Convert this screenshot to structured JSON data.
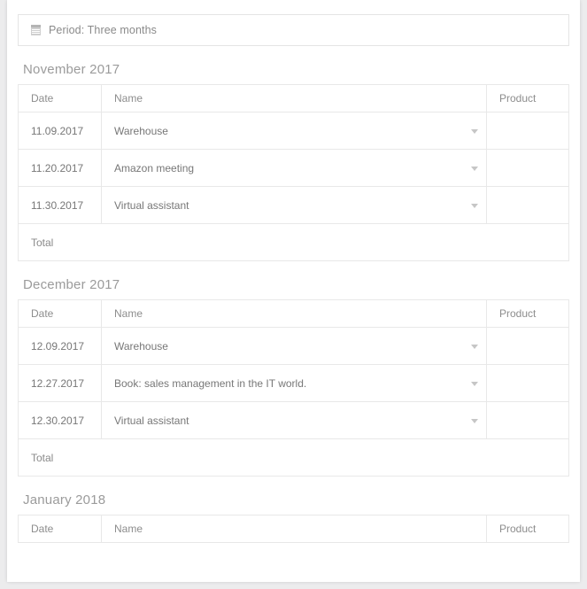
{
  "filter": {
    "icon": "calendar-icon",
    "label": "Period: Three months"
  },
  "columns": {
    "date": "Date",
    "name": "Name",
    "product": "Product"
  },
  "total_label": "Total",
  "sections": [
    {
      "title": "November 2017",
      "has_total": true,
      "rows": [
        {
          "date": "11.09.2017",
          "name": "Warehouse",
          "product": ""
        },
        {
          "date": "11.20.2017",
          "name": "Amazon meeting",
          "product": ""
        },
        {
          "date": "11.30.2017",
          "name": "Virtual assistant",
          "product": ""
        }
      ]
    },
    {
      "title": "December 2017",
      "has_total": true,
      "rows": [
        {
          "date": "12.09.2017",
          "name": "Warehouse",
          "product": ""
        },
        {
          "date": "12.27.2017",
          "name": "Book: sales management in the IT world.",
          "product": ""
        },
        {
          "date": "12.30.2017",
          "name": "Virtual assistant",
          "product": ""
        }
      ]
    },
    {
      "title": "January 2018",
      "has_total": false,
      "rows": []
    }
  ],
  "colors": {
    "page_background": "#ececed",
    "card_background": "#ffffff",
    "border": "#e8e8e8",
    "text": "#777777",
    "heading_text": "#9b9b9b",
    "caret": "#c6c6c6"
  }
}
